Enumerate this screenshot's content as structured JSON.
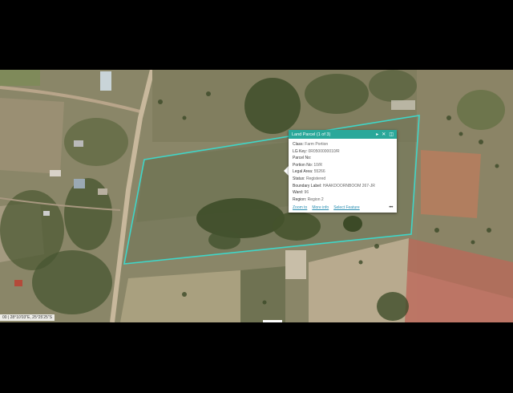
{
  "map": {
    "coordinates": "00 | 28°10'03\"E, 25°25'25\"S",
    "parcel_outline_color": "#3fd6c8",
    "accent_color": "#2aa89a"
  },
  "popup": {
    "title": "Land Parcel (1 of 3)",
    "icons": [
      "play-next-icon",
      "close-icon",
      "maximize-icon"
    ],
    "fields": [
      {
        "label": "Class:",
        "value": "Farm Portion"
      },
      {
        "label": "LG Key:",
        "value": "0R0500000010/R"
      },
      {
        "label": "Parcel No:",
        "value": ""
      },
      {
        "label": "Portion No:",
        "value": "10/R"
      },
      {
        "label": "Legal Area:",
        "value": "55266"
      },
      {
        "label": "Status:",
        "value": "Registered"
      },
      {
        "label": "Boundary Label:",
        "value": "HAAKDOORNBOOM 267-JR"
      },
      {
        "label": "Ward:",
        "value": "96"
      },
      {
        "label": "Region:",
        "value": "Region 2"
      }
    ],
    "actions": {
      "zoom": "Zoom to",
      "more_info": "More info",
      "select": "Select Feature",
      "overflow": "•••"
    }
  }
}
